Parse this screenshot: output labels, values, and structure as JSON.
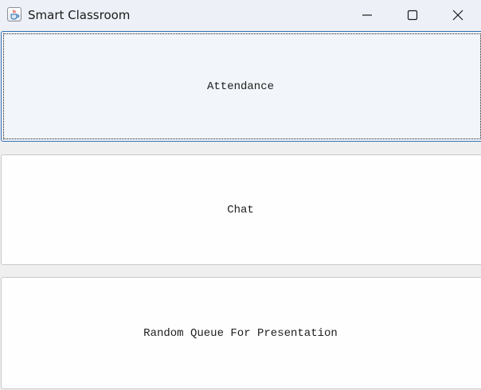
{
  "window": {
    "title": "Smart Classroom",
    "icon": "java-cup-icon"
  },
  "controls": {
    "minimize": "minimize-icon",
    "maximize": "maximize-icon",
    "close": "close-icon"
  },
  "buttons": [
    {
      "label": "Attendance",
      "focused": true
    },
    {
      "label": "Chat",
      "focused": false
    },
    {
      "label": "Random Queue For Presentation",
      "focused": false
    }
  ],
  "colors": {
    "titlebar": "#eef0f7",
    "focus_border": "#2d6fb6",
    "button_bg": "#fefefe",
    "focused_bg": "#f2f6fb"
  }
}
